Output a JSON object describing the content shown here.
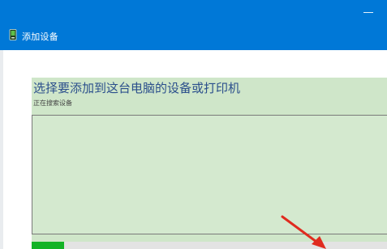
{
  "window": {
    "title": "添加设备",
    "minimize_icon": "minimize-icon",
    "app_icon": "add-device-icon"
  },
  "main": {
    "heading": "选择要添加到这台电脑的设备或打印机",
    "status": "正在搜索设备",
    "device_list": []
  },
  "progress": {
    "value": 0.09
  },
  "colors": {
    "titlebar": "#0078d7",
    "panel": "#cfe6c9",
    "heading": "#2b4f8c",
    "progress": "#13b326",
    "annotation_arrow": "#e02b1f"
  },
  "annotation": {
    "icon": "red-arrow-icon"
  }
}
